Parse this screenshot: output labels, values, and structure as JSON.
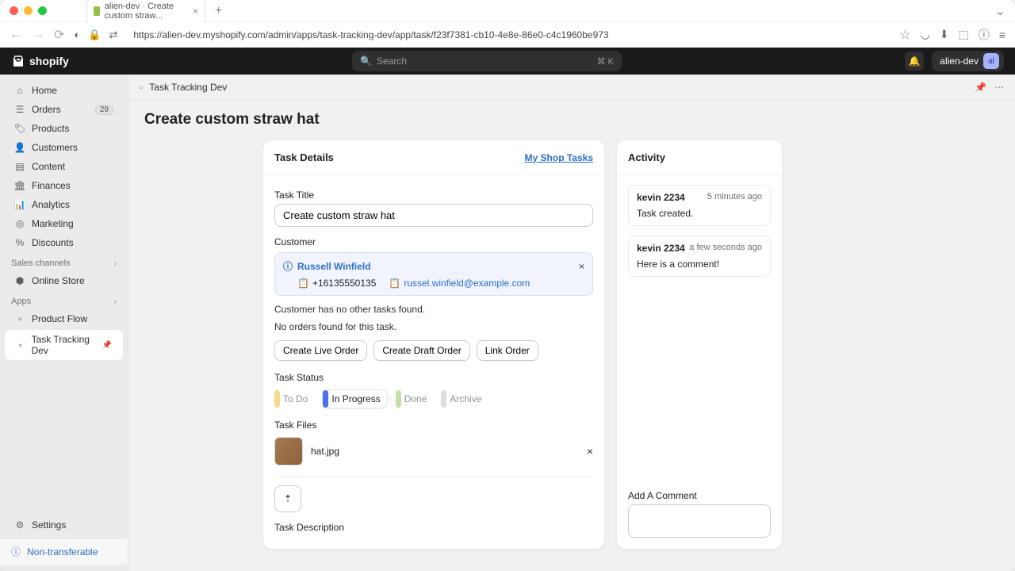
{
  "browser": {
    "tab_title": "alien-dev · Create custom straw...",
    "url": "https://alien-dev.myshopify.com/admin/apps/task-tracking-dev/app/task/f23f7381-cb10-4e8e-86e0-c4c1960be973"
  },
  "topbar": {
    "brand": "shopify",
    "search_placeholder": "Search",
    "search_kbd": "⌘ K",
    "store_name": "alien-dev",
    "avatar_initials": "al"
  },
  "sidebar": {
    "items": [
      {
        "label": "Home"
      },
      {
        "label": "Orders",
        "badge": "29"
      },
      {
        "label": "Products"
      },
      {
        "label": "Customers"
      },
      {
        "label": "Content"
      },
      {
        "label": "Finances"
      },
      {
        "label": "Analytics"
      },
      {
        "label": "Marketing"
      },
      {
        "label": "Discounts"
      }
    ],
    "channels_head": "Sales channels",
    "channels": [
      {
        "label": "Online Store"
      }
    ],
    "apps_head": "Apps",
    "apps": [
      {
        "label": "Product Flow"
      },
      {
        "label": "Task Tracking Dev",
        "pinned": true
      }
    ],
    "settings": "Settings",
    "nontransferable": "Non-transferable"
  },
  "breadcrumb": {
    "app": "Task Tracking Dev"
  },
  "page": {
    "title": "Create custom straw hat"
  },
  "details": {
    "header": "Task Details",
    "link": "My Shop Tasks",
    "title_label": "Task Title",
    "title_value": "Create custom straw hat",
    "customer_label": "Customer",
    "customer": {
      "name": "Russell Winfield",
      "phone": "+16135550135",
      "email": "russel.winfield@example.com"
    },
    "no_tasks": "Customer has no other tasks found.",
    "no_orders": "No orders found for this task.",
    "buttons": {
      "live": "Create Live Order",
      "draft": "Create Draft Order",
      "link": "Link Order"
    },
    "status_label": "Task Status",
    "statuses": {
      "todo": "To Do",
      "inprogress": "In Progress",
      "done": "Done",
      "archive": "Archive"
    },
    "status_colors": {
      "todo": "#f2d98c",
      "inprogress": "#4f6ef7",
      "done": "#c1e0a5",
      "archive": "#d9dbe0"
    },
    "files_label": "Task Files",
    "file": "hat.jpg",
    "desc_label": "Task Description"
  },
  "activity": {
    "header": "Activity",
    "items": [
      {
        "user": "kevin 2234",
        "time": "5 minutes ago",
        "text": "Task created."
      },
      {
        "user": "kevin 2234",
        "time": "a few seconds ago",
        "text": "Here is a comment!"
      }
    ],
    "comment_label": "Add A Comment"
  }
}
